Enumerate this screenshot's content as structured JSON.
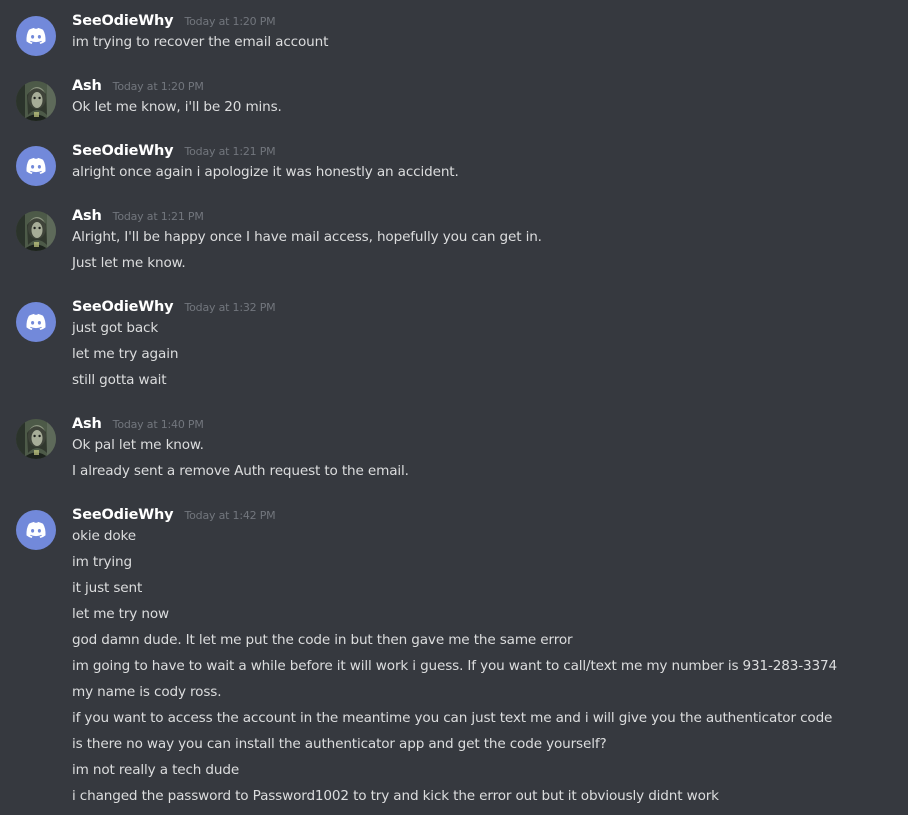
{
  "colors": {
    "background": "#36393f",
    "username": "#ffffff",
    "timestamp": "#72767d",
    "message_text": "#dcddde",
    "discord_avatar": "#7289da"
  },
  "messages": [
    {
      "author": "SeeOdieWhy",
      "avatar": "discord-logo-icon",
      "timestamp": "Today at 1:20 PM",
      "lines": [
        "im trying to recover the email account"
      ]
    },
    {
      "author": "Ash",
      "avatar": "user-photo-avatar",
      "timestamp": "Today at 1:20 PM",
      "lines": [
        "Ok let me know, i'll be 20 mins."
      ]
    },
    {
      "author": "SeeOdieWhy",
      "avatar": "discord-logo-icon",
      "timestamp": "Today at 1:21 PM",
      "lines": [
        "alright once again i apologize it was honestly an accident."
      ]
    },
    {
      "author": "Ash",
      "avatar": "user-photo-avatar",
      "timestamp": "Today at 1:21 PM",
      "lines": [
        "Alright, I'll be happy once I have mail access, hopefully you can get in.",
        "Just let me know."
      ]
    },
    {
      "author": "SeeOdieWhy",
      "avatar": "discord-logo-icon",
      "timestamp": "Today at 1:32 PM",
      "lines": [
        "just got back",
        "let me try again",
        "still gotta wait"
      ]
    },
    {
      "author": "Ash",
      "avatar": "user-photo-avatar",
      "timestamp": "Today at 1:40 PM",
      "lines": [
        "Ok pal let me know.",
        "I already sent a remove Auth request to the email."
      ]
    },
    {
      "author": "SeeOdieWhy",
      "avatar": "discord-logo-icon",
      "timestamp": "Today at 1:42 PM",
      "lines": [
        "okie doke",
        "im trying",
        "it just sent",
        "let me try now",
        "god damn dude.  It let me put the code in but then gave me the same error",
        "im going to have to wait a while before it will work i guess.  If you want to call/text me my number is 931-283-3374",
        "my name is cody ross.",
        "if you want to access the account in the meantime you can just text me and i will give you the authenticator code",
        "is there no way you can install the authenticator app and get the code yourself?",
        "im not really a tech dude",
        "i changed the password to Password1002 to try and kick the error out but it obviously didnt work"
      ]
    }
  ]
}
